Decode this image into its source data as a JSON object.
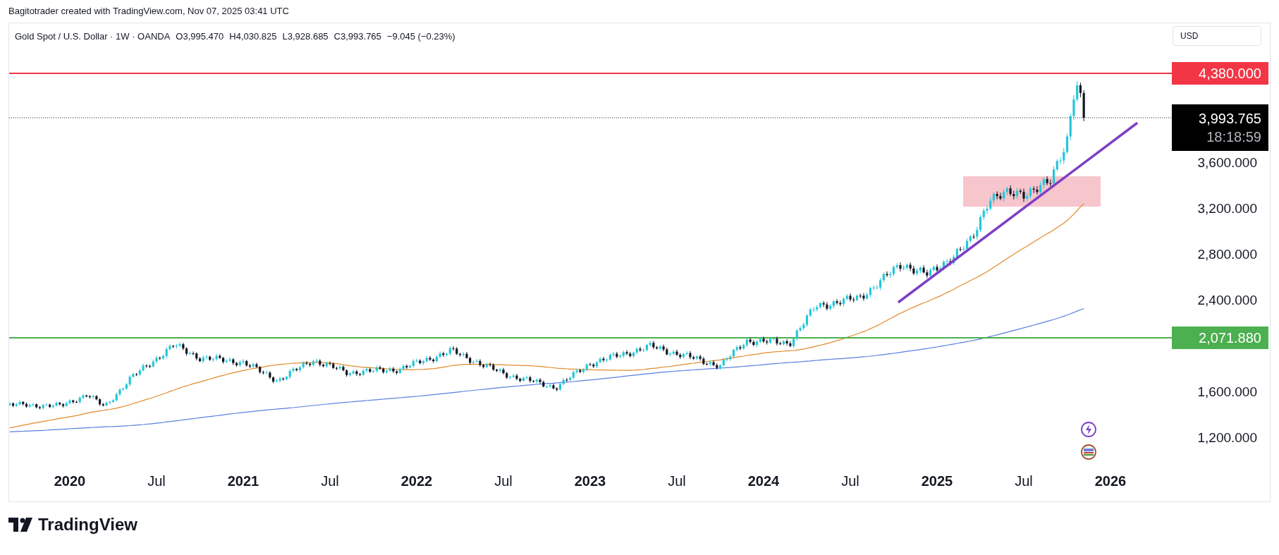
{
  "attribution": "Bagitotrader created with TradingView.com, Nov 07, 2025 03:41 UTC",
  "legend": {
    "symbol": "Gold Spot / U.S. Dollar · 1W · OANDA",
    "values": [
      "O3,995.470",
      "H4,030.825",
      "L3,928.685",
      "C3,993.765",
      "−9.045 (−0.23%)"
    ]
  },
  "currency_button": "USD",
  "price_axis": [
    "3,600.000",
    "3,200.000",
    "2,800.000",
    "2,400.000",
    "1,600.000",
    "1,200.000"
  ],
  "price_lines": [
    {
      "label": "4,380.000",
      "color": "#f23645"
    },
    {
      "label": "2,071.880",
      "color": "#4caf50"
    }
  ],
  "last_price": {
    "value": "3,993.765",
    "countdown": "18:18:59"
  },
  "time_axis": [
    {
      "label": "2020",
      "kind": "year"
    },
    {
      "label": "Jul",
      "kind": "month"
    },
    {
      "label": "2021",
      "kind": "year"
    },
    {
      "label": "Jul",
      "kind": "month"
    },
    {
      "label": "2022",
      "kind": "year"
    },
    {
      "label": "Jul",
      "kind": "month"
    },
    {
      "label": "2023",
      "kind": "year"
    },
    {
      "label": "Jul",
      "kind": "month"
    },
    {
      "label": "2024",
      "kind": "year"
    },
    {
      "label": "Jul",
      "kind": "month"
    },
    {
      "label": "2025",
      "kind": "year"
    },
    {
      "label": "Jul",
      "kind": "month"
    },
    {
      "label": "2026",
      "kind": "year"
    }
  ],
  "footer": {
    "brand": "TradingView"
  }
}
